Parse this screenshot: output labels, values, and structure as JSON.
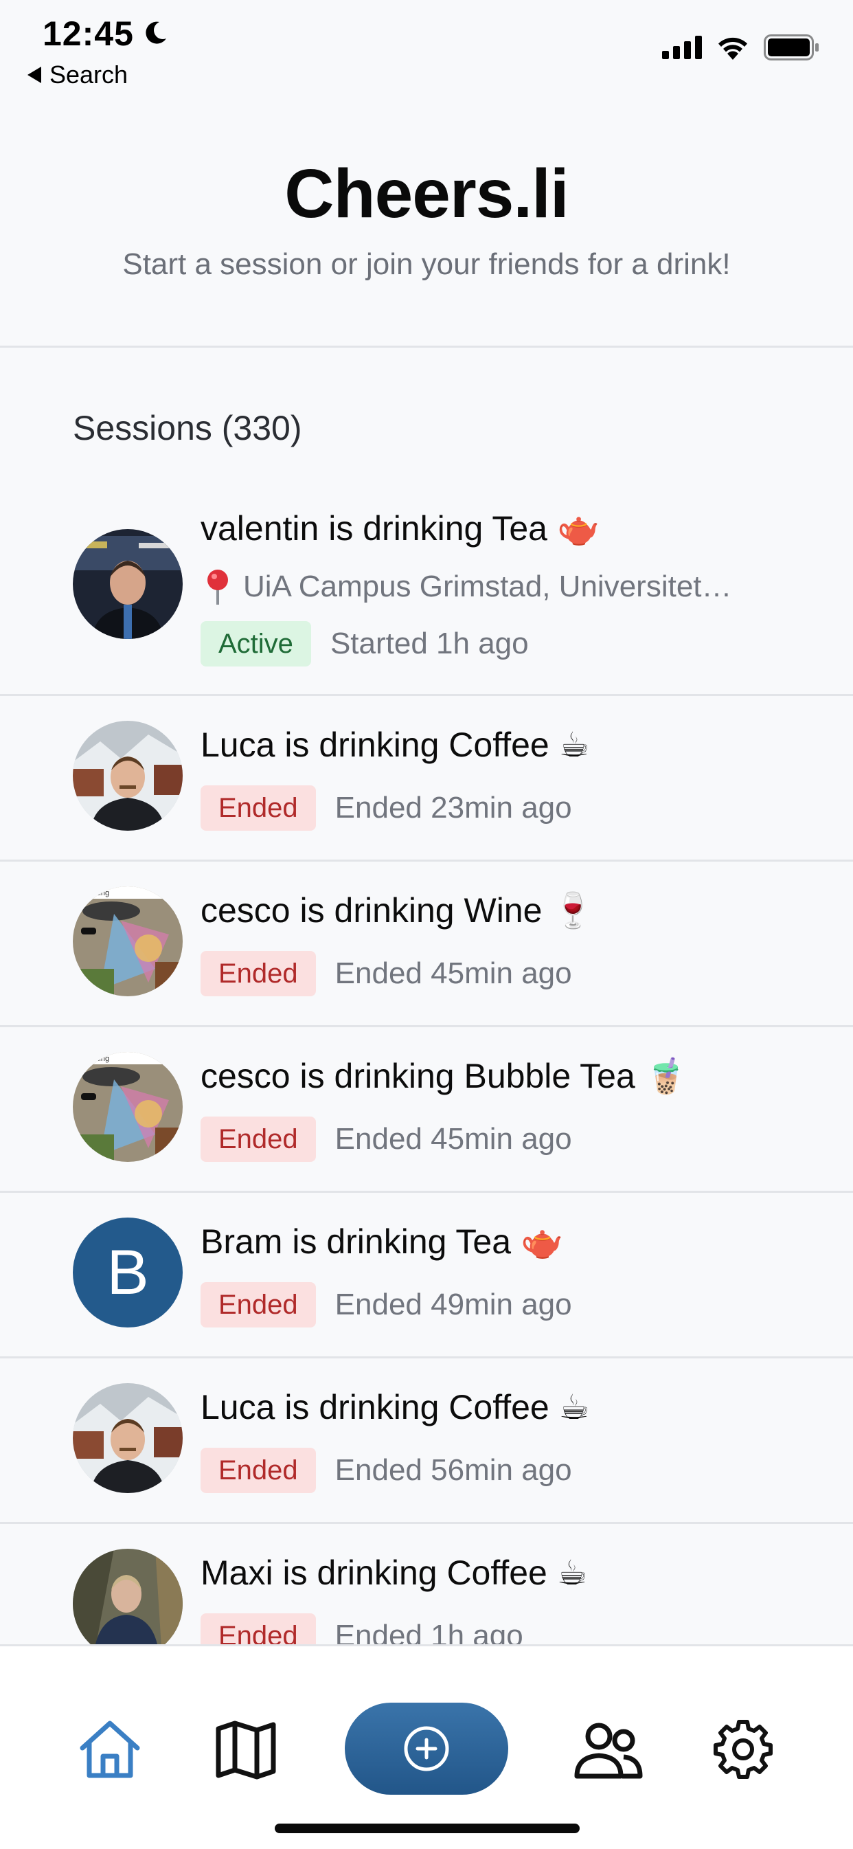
{
  "status_bar": {
    "time": "12:45",
    "back_label": "Search"
  },
  "header": {
    "title": "Cheers.li",
    "subtitle": "Start a session or join your friends for a drink!"
  },
  "sessions": {
    "heading": "Sessions (330)",
    "items": [
      {
        "title": "valentin is drinking Tea",
        "emoji": "🫖",
        "location": "UiA Campus Grimstad, Universitet…",
        "status": "Active",
        "time_text": "Started 1h ago",
        "avatar": "photo-valentin"
      },
      {
        "title": "Luca is drinking Coffee",
        "emoji": "☕",
        "status": "Ended",
        "time_text": "Ended 23min ago",
        "avatar": "photo-luca"
      },
      {
        "title": "cesco is drinking Wine",
        "emoji": "🍷",
        "status": "Ended",
        "time_text": "Ended 45min ago",
        "avatar": "photo-cesco"
      },
      {
        "title": "cesco is drinking Bubble Tea",
        "emoji": "🧋",
        "status": "Ended",
        "time_text": "Ended 45min ago",
        "avatar": "photo-cesco"
      },
      {
        "title": "Bram is drinking Tea",
        "emoji": "🫖",
        "status": "Ended",
        "time_text": "Ended 49min ago",
        "avatar_letter": "B"
      },
      {
        "title": "Luca is drinking Coffee",
        "emoji": "☕",
        "status": "Ended",
        "time_text": "Ended 56min ago",
        "avatar": "photo-luca"
      },
      {
        "title": "Maxi is drinking Coffee",
        "emoji": "☕",
        "status": "Ended",
        "time_text": "Ended 1h ago",
        "avatar": "photo-maxi"
      }
    ]
  },
  "nav": {
    "items": [
      "home-icon",
      "map-icon",
      "add-session-icon",
      "friends-icon",
      "settings-icon"
    ],
    "active": "home-icon"
  },
  "colors": {
    "accent": "#235a8c",
    "active_badge_bg": "#dcf5e3",
    "active_badge_text": "#1f6b37",
    "ended_badge_bg": "#fbe0e0",
    "ended_badge_text": "#b02a2a",
    "nav_active": "#3a7fc4"
  }
}
